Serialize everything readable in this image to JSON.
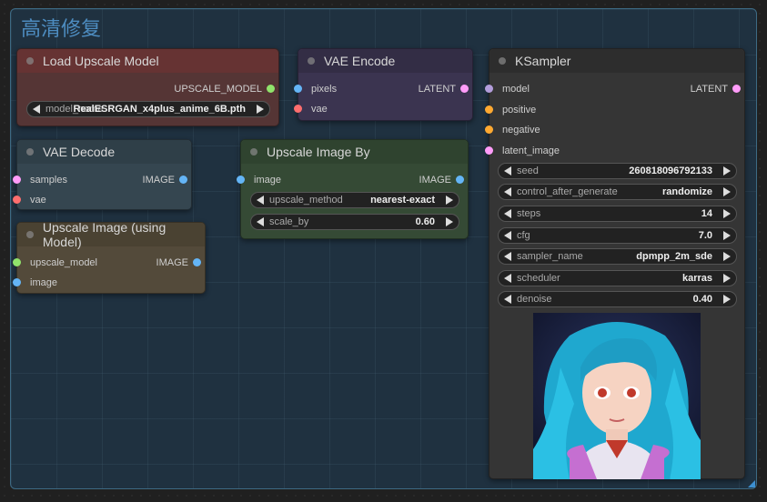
{
  "group": {
    "title": "高清修复"
  },
  "colors": {
    "model_slot": "#90e36b",
    "image_slot": "#64b5f6",
    "vae_slot": "#ff6e6e",
    "latent_slot": "#ff9cf9",
    "conditioning_slot": "#ffa931",
    "purple_slot": "#b39ddb"
  },
  "nodes": {
    "load_upscale_model": {
      "title": "Load Upscale Model",
      "output": "UPSCALE_MODEL",
      "widget_label": "model_name",
      "widget_value": "RealESRGAN_x4plus_anime_6B.pth"
    },
    "vae_encode": {
      "title": "VAE Encode",
      "inputs": [
        "pixels",
        "vae"
      ],
      "output": "LATENT"
    },
    "vae_decode": {
      "title": "VAE Decode",
      "inputs": [
        "samples",
        "vae"
      ],
      "output": "IMAGE"
    },
    "upscale_image_by": {
      "title": "Upscale Image By",
      "input": "image",
      "output": "IMAGE",
      "widgets": [
        {
          "label": "upscale_method",
          "value": "nearest-exact"
        },
        {
          "label": "scale_by",
          "value": "0.60"
        }
      ]
    },
    "upscale_image_model": {
      "title": "Upscale Image (using Model)",
      "inputs": [
        "upscale_model",
        "image"
      ],
      "output": "IMAGE"
    },
    "ksampler": {
      "title": "KSampler",
      "inputs": [
        "model",
        "positive",
        "negative",
        "latent_image"
      ],
      "output": "LATENT",
      "widgets": [
        {
          "label": "seed",
          "value": "260818096792133"
        },
        {
          "label": "control_after_generate",
          "value": "randomize"
        },
        {
          "label": "steps",
          "value": "14"
        },
        {
          "label": "cfg",
          "value": "7.0"
        },
        {
          "label": "sampler_name",
          "value": "dpmpp_2m_sde"
        },
        {
          "label": "scheduler",
          "value": "karras"
        },
        {
          "label": "denoise",
          "value": "0.40"
        }
      ]
    }
  }
}
